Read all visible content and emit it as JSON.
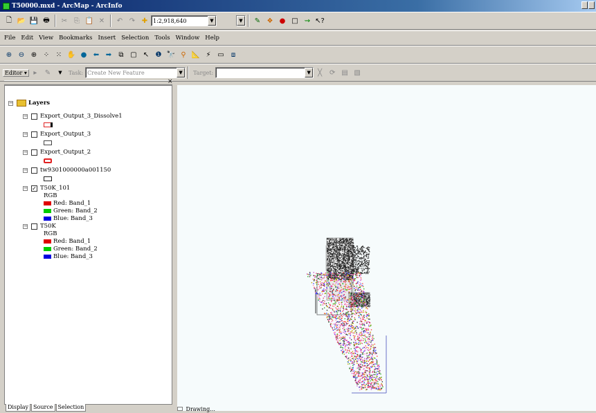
{
  "window": {
    "title": "T50000.mxd - ArcMap - ArcInfo"
  },
  "standard_toolbar": {
    "scale_value": "1:2,918,640"
  },
  "menu": [
    "File",
    "Edit",
    "View",
    "Bookmarks",
    "Insert",
    "Selection",
    "Tools",
    "Window",
    "Help"
  ],
  "editor_toolbar": {
    "editor_label": "Editor ▾",
    "task_label": "Task:",
    "task_value": "Create New Feature",
    "target_label": "Target:",
    "target_value": ""
  },
  "toc": {
    "root_label": "Layers",
    "layers": [
      {
        "name": "Export_Output_3_Dissolve1",
        "checked": false
      },
      {
        "name": "Export_Output_3",
        "checked": false
      },
      {
        "name": "Export_Output_2",
        "checked": false
      },
      {
        "name": "tw9301000000a001150",
        "checked": false
      },
      {
        "name": "T50K_101",
        "checked": true,
        "rgb_label": "RGB",
        "bands": [
          {
            "text": "Red:  Band_1",
            "color": "#e00000"
          },
          {
            "text": "Green: Band_2",
            "color": "#00cc00"
          },
          {
            "text": "Blue:  Band_3",
            "color": "#0000e0"
          }
        ]
      },
      {
        "name": "T50K",
        "checked": false,
        "rgb_label": "RGB",
        "bands": [
          {
            "text": "Red:  Band_1",
            "color": "#e00000"
          },
          {
            "text": "Green: Band_2",
            "color": "#00cc00"
          },
          {
            "text": "Blue:  Band_3",
            "color": "#0000e0"
          }
        ]
      }
    ],
    "tabs": [
      "Display",
      "Source",
      "Selection"
    ]
  },
  "statusbar": {
    "text": "Drawing..."
  }
}
